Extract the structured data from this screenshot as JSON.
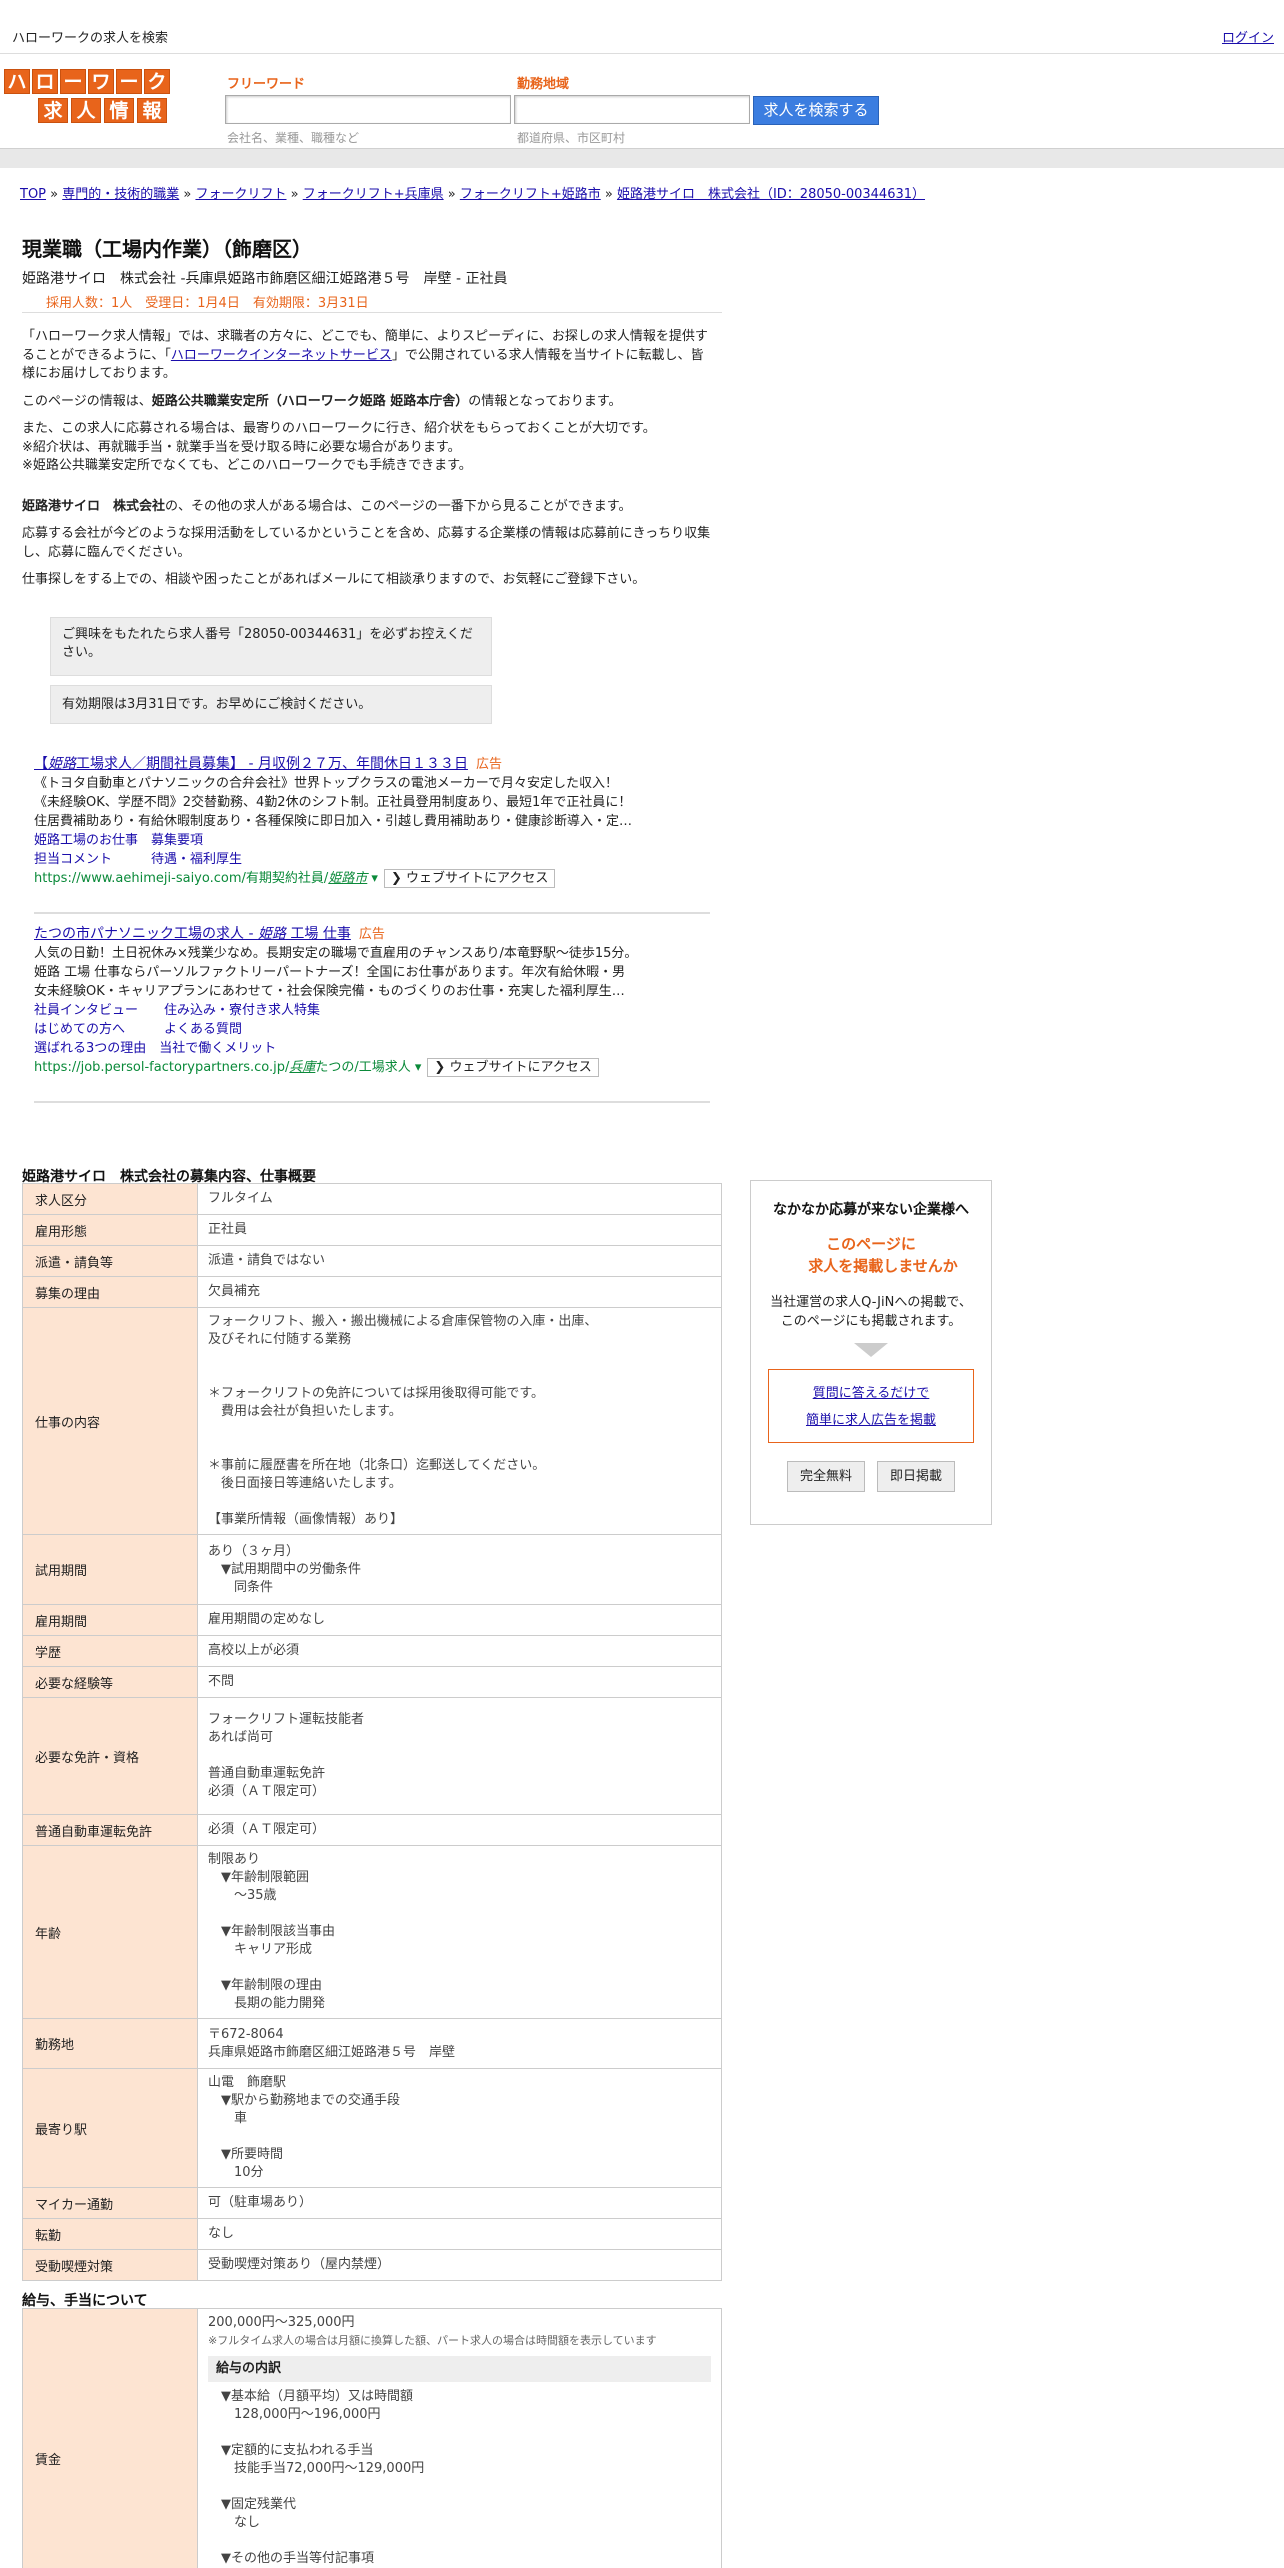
{
  "header": {
    "title": "ハローワークの求人を検索",
    "login": "ログイン"
  },
  "logo": {
    "row1": [
      "ハ",
      "ロ",
      "ー",
      "ワ",
      "ー",
      "ク"
    ],
    "row2": [
      "求",
      "人",
      "情",
      "報"
    ]
  },
  "search": {
    "keyword_label": "フリーワード",
    "keyword_hint": "会社名、業種、職種など",
    "area_label": "勤務地域",
    "area_hint": "都道府県、市区町村",
    "button": "求人を検索する"
  },
  "breadcrumb": [
    "TOP",
    "専門的・技術的職業",
    "フォークリフト",
    "フォークリフト+兵庫県",
    "フォークリフト+姫路市",
    "姫路港サイロ　株式会社（ID：28050-00344631）"
  ],
  "job": {
    "title": "現業職（工場内作業）（飾磨区）",
    "company_line": "姫路港サイロ　株式会社 -兵庫県姫路市飾磨区細江姫路港５号　岸壁 - 正社員",
    "meta": "採用人数：1人　受理日：1月4日　有効期限：3月31日"
  },
  "intro": {
    "p1a": "「ハローワーク求人情報」では、求職者の方々に、どこでも、簡単に、よりスピーディに、お探しの求人情報を提供することができるように、「",
    "p1link": "ハローワークインターネットサービス",
    "p1b": "」で公開されている求人情報を当サイトに転載し、皆様にお届けしております。",
    "p2a": "このページの情報は、",
    "p2b": "姫路公共職業安定所（ハローワーク姫路 姫路本庁舎）",
    "p2c": "の情報となっております。",
    "p3": [
      "また、この求人に応募される場合は、最寄りのハローワークに行き、紹介状をもらっておくことが大切です。",
      "※紹介状は、再就職手当・就業手当を受け取る時に必要な場合があります。",
      "※姫路公共職業安定所でなくても、どこのハローワークでも手続きできます。"
    ],
    "p4a": "姫路港サイロ　株式会社",
    "p4b": "の、その他の求人がある場合は、このページの一番下から見ることができます。",
    "p5": "応募する会社が今どのような採用活動をしているかということを含め、応募する企業様の情報は応募前にきっちり収集し、応募に臨んでください。",
    "p6": "仕事探しをする上での、相談や困ったことがあればメールにて相談承りますので、お気軽にご登録下さい。"
  },
  "notes": [
    "ご興味をもたれたら求人番号「28050-00344631」を必ずお控えください。",
    "有効期限は3月31日です。お早めにご検討ください。"
  ],
  "ads": [
    {
      "title_a": "【",
      "title_i": "姫路",
      "title_b": "工場求人／期間社員募集】 - 月収例２７万、年間休日１３３日",
      "tag": "広告",
      "lines": [
        "《トヨタ自動車とパナソニックの合弁会社》世界トップクラスの電池メーカーで月々安定した収入！",
        "《未経験OK、学歴不問》2交替勤務、4勤2休のシフト制。正社員登用制度あり、最短1年で正社員に！",
        "住居費補助あり・有給休暇制度あり・各種保険に即日加入・引越し費用補助あり・健康診断導入・定…"
      ],
      "sitelinks": [
        [
          "姫路工場のお仕事",
          "募集要項"
        ],
        [
          "担当コメント",
          "待遇・福利厚生"
        ]
      ],
      "url_a": "https://www.aehimeji-saiyo.com/有期契約社員/",
      "url_i": "姫路市",
      "url_b": " ▾",
      "button": "❯ ウェブサイトにアクセス"
    },
    {
      "title_a": "たつの市パナソニック工場の求人 - ",
      "title_i": "姫路",
      "title_b": " 工場 仕事",
      "tag": "広告",
      "lines": [
        "人気の日勤！土日祝休み×残業少なめ。長期安定の職場で直雇用のチャンスあり/本竜野駅～徒歩15分。",
        "姫路 工場 仕事ならパーソルファクトリーパートナーズ！全国にお仕事があります。年次有給休暇・男",
        "女未経験OK・キャリアプランにあわせて・社会保険完備・ものづくりのお仕事・充実した福利厚生…"
      ],
      "sitelinks": [
        [
          "社員インタビュー",
          "住み込み・寮付き求人特集"
        ],
        [
          "はじめての方へ",
          "よくある質問"
        ],
        [
          "選ばれる3つの理由",
          "当社で働くメリット"
        ]
      ],
      "url_a": "https://job.persol-factorypartners.co.jp/",
      "url_i": "兵庫",
      "url_b": "たつの/工場求人 ▾",
      "button": "❯ ウェブサイトにアクセス"
    }
  ],
  "details": {
    "title": "姫路港サイロ　株式会社の募集内容、仕事概要",
    "rows": [
      {
        "k": "求人区分",
        "v": "フルタイム"
      },
      {
        "k": "雇用形態",
        "v": "正社員"
      },
      {
        "k": "派遣・請負等",
        "v": "派遣・請負ではない"
      },
      {
        "k": "募集の理由",
        "v": "欠員補充"
      },
      {
        "k": "仕事の内容",
        "v": "フォークリフト、搬入・搬出機械による倉庫保管物の入庫・出庫、\n及びそれに付随する業務\n\n\n＊フォークリフトの免許については採用後取得可能です。\n　費用は会社が負担いたします。\n\n\n＊事前に履歴書を所在地（北条口）迄郵送してください。\n　後日面接日等連絡いたします。\n\n【事業所情報（画像情報）あり】"
      },
      {
        "k": "試用期間",
        "v": "あり（３ヶ月）\n　▼試用期間中の労働条件\n　　同条件"
      },
      {
        "k": "雇用期間",
        "v": "雇用期間の定めなし"
      },
      {
        "k": "学歴",
        "v": "高校以上が必須"
      },
      {
        "k": "必要な経験等",
        "v": "不問"
      },
      {
        "k": "必要な免許・資格",
        "v": "フォークリフト運転技能者\nあれば尚可\n\n普通自動車運転免許\n必須（ＡＴ限定可）\n"
      },
      {
        "k": "普通自動車運転免許",
        "v": "必須（ＡＴ限定可）"
      },
      {
        "k": "年齢",
        "v": "制限あり\n　▼年齢制限範囲\n　　〜35歳\n\n　▼年齢制限該当事由\n　　キャリア形成\n\n　▼年齢制限の理由\n　　長期の能力開発"
      },
      {
        "k": "勤務地",
        "v": "〒672-8064\n兵庫県姫路市飾磨区細江姫路港５号　岸壁"
      },
      {
        "k": "最寄り駅",
        "v": "山電　飾磨駅\n　▼駅から勤務地までの交通手段\n　　車\n\n　▼所要時間\n　　10分"
      },
      {
        "k": "マイカー通勤",
        "v": "可（駐車場あり）"
      },
      {
        "k": "転勤",
        "v": "なし"
      },
      {
        "k": "受動喫煙対策",
        "v": "受動喫煙対策あり（屋内禁煙）"
      }
    ]
  },
  "salary": {
    "title": "給与、手当について",
    "key": "賃金",
    "range": "200,000円〜325,000円",
    "note": "※フルタイム求人の場合は月額に換算した額、パート求人の場合は時間額を表示しています",
    "subtitle": "給与の内訳",
    "items": "　▼基本給（月額平均）又は時間額\n　　128,000円〜196,000円\n\n　▼定額的に支払われる手当\n　　技能手当72,000円〜129,000円\n\n　▼固定残業代\n　　なし\n\n　▼その他の手当等付記事項\n　　残業手当"
  },
  "sidebar": {
    "heading": "なかなか応募が来ない企業様へ",
    "big1": "このページに",
    "big2": "求人を掲載しませんか",
    "txt1": "当社運営の求人Q-JiNへの掲載で、",
    "txt2": "このページにも掲載されます。",
    "link1": "質問に答えるだけで",
    "link2": "簡単に求人広告を掲載",
    "btn1": "完全無料",
    "btn2": "即日掲載"
  }
}
